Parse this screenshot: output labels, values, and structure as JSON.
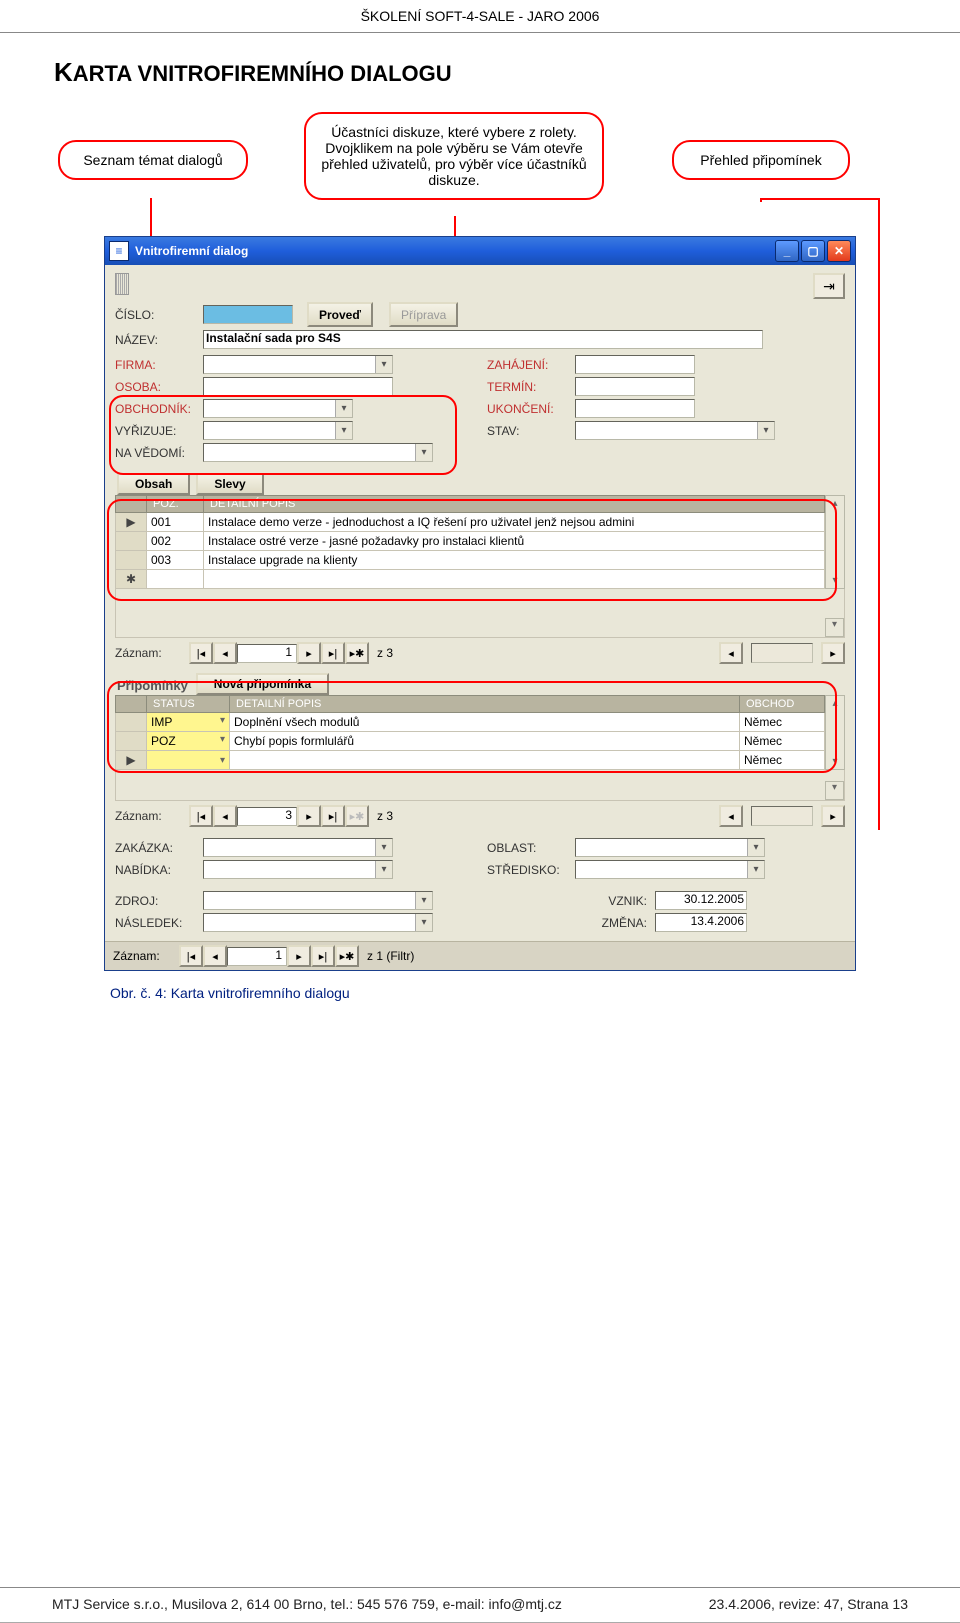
{
  "doc": {
    "header": "ŠKOLENÍ SOFT-4-SALE - JARO 2006",
    "heading_pre": "K",
    "heading_rest": "ARTA VNITROFIREMNÍHO DIALOGU",
    "callout_left": "Seznam témat dialogů",
    "callout_mid": "Účastníci diskuze, které vybere z rolety. Dvojklikem na pole výběru se Vám otevře přehled uživatelů, pro výběr více účastníků diskuze.",
    "callout_right": "Přehled připomínek",
    "caption": "Obr. č. 4: Karta vnitrofiremního dialogu",
    "footer_left": "MTJ Service s.r.o., Musilova 2, 614 00 Brno, tel.: 545 576 759, e-mail: info@mtj.cz",
    "footer_right": "23.4.2006, revize: 47, Strana 13"
  },
  "win": {
    "title": "Vnitrofiremní dialog",
    "btn_proved": "Proveď",
    "btn_priprava": "Příprava",
    "labels": {
      "cislo": "ČÍSLO:",
      "nazev": "NÁZEV:",
      "firma": "FIRMA:",
      "osoba": "OSOBA:",
      "obchodnik": "OBCHODNÍK:",
      "vyrizuje": "VYŘIZUJE:",
      "navedomi": "NA VĚDOMÍ:",
      "zahajeni": "ZAHÁJENÍ:",
      "termin": "TERMÍN:",
      "ukonceni": "UKONČENÍ:",
      "stav": "STAV:",
      "zakazka": "ZAKÁZKA:",
      "nabidka": "NABÍDKA:",
      "zdroj": "ZDROJ:",
      "nasledek": "NÁSLEDEK:",
      "oblast": "OBLAST:",
      "stredisko": "STŘEDISKO:",
      "vznik": "VZNIK:",
      "zmena": "ZMĚNA:",
      "zaznam": "Záznam:"
    },
    "values": {
      "nazev": "Instalační sada pro S4S",
      "vznik": "30.12.2005",
      "zmena": "13.4.2006"
    },
    "tabs": {
      "obsah": "Obsah",
      "slevy": "Slevy",
      "pripominky": "Připomínky",
      "nova_prip": "Nová připomínka"
    },
    "grid1": {
      "header_poz": "POZ.",
      "header_detail": "DETAILNÍ POPIS",
      "rows": [
        {
          "poz": "001",
          "popis": "Instalace demo verze - jednoduchost a IQ řešení pro uživatel jenž nejsou admini"
        },
        {
          "poz": "002",
          "popis": "Instalace ostré verze - jasné požadavky pro instalaci klientů"
        },
        {
          "poz": "003",
          "popis": "Instalace upgrade na klienty"
        }
      ],
      "rec_val": "1",
      "rec_of": "z 3"
    },
    "grid2": {
      "header_status": "STATUS",
      "header_detail": "DETAILNÍ POPIS",
      "header_obchod": "OBCHOD",
      "rows": [
        {
          "status": "IMP",
          "popis": "Doplnění všech modulů",
          "obchod": "Němec"
        },
        {
          "status": "POZ",
          "popis": "Chybí popis formlulářů",
          "obchod": "Němec"
        },
        {
          "status": "",
          "popis": "",
          "obchod": "Němec"
        }
      ],
      "rec_val": "3",
      "rec_of": "z 3"
    },
    "footer_rec": {
      "val": "1",
      "of": "z 1 (Filtr)"
    }
  }
}
